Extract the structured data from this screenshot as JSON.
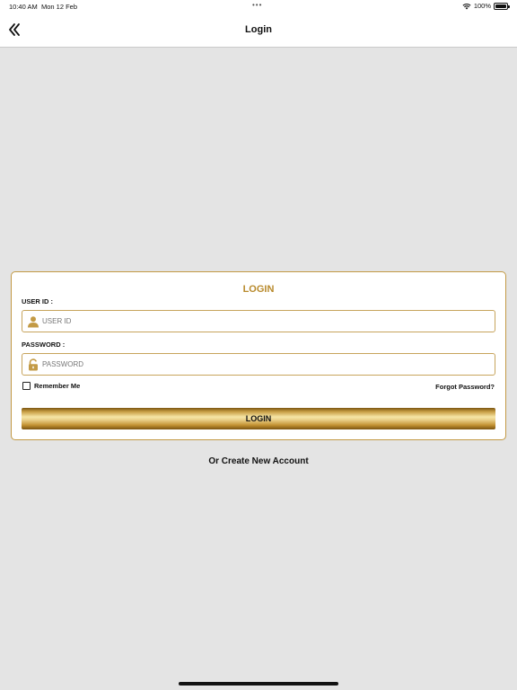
{
  "status_bar": {
    "time": "10:40 AM",
    "date": "Mon 12 Feb",
    "battery": "100%",
    "wifi_icon": "wifi-icon",
    "battery_icon": "battery-icon"
  },
  "nav": {
    "title": "Login",
    "back_icon": "double-chevron-left-icon"
  },
  "login_card": {
    "title": "LOGIN",
    "user_id": {
      "label": "USER ID :",
      "placeholder": "USER ID",
      "value": "",
      "icon": "user-icon"
    },
    "password": {
      "label": "PASSWORD :",
      "placeholder": "PASSWORD",
      "value": "",
      "icon": "lock-icon"
    },
    "remember_me": "Remember Me",
    "forgot_password": "Forgot Password?",
    "login_button": "LOGIN"
  },
  "create_account": "Or Create New Account",
  "colors": {
    "accent_gold": "#c39a45",
    "title_gold": "#b88a2c",
    "background": "#e4e4e4"
  }
}
